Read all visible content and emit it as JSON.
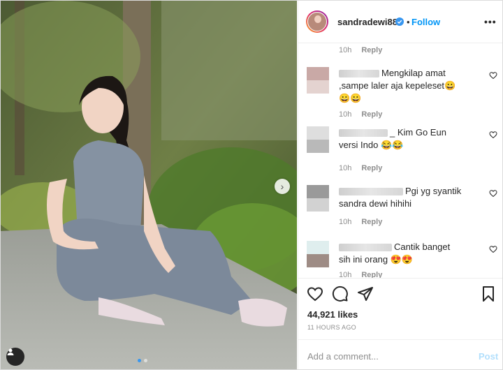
{
  "post": {
    "username": "sandradewi88",
    "separator": "•",
    "follow_label": "Follow",
    "more_label": "•••",
    "carousel": {
      "slide_count": 2,
      "active_slide": 1
    }
  },
  "comments": [
    {
      "time": "10h",
      "reply": "Reply",
      "text": "",
      "partial": true
    },
    {
      "time": "10h",
      "reply": "Reply",
      "text": "Mengkilap amat ,sampe laler aja kepeleset",
      "emojis": "😀😀😀"
    },
    {
      "time": "10h",
      "reply": "Reply",
      "text": "_ Kim Go Eun versi Indo",
      "emojis": "😂😂"
    },
    {
      "time": "10h",
      "reply": "Reply",
      "text": "Pgi yg syantik sandra dewi hihihi",
      "emojis": ""
    },
    {
      "time": "10h",
      "reply": "Reply",
      "text": "Cantik banget sih ini orang",
      "emojis": "😍😍"
    }
  ],
  "actions": {
    "likes": "44,921 likes",
    "time_ago": "11 HOURS AGO"
  },
  "add_comment": {
    "placeholder": "Add a comment...",
    "post_label": "Post"
  },
  "colors": {
    "accent": "#0095f6",
    "post_disabled": "#b2dffc"
  }
}
